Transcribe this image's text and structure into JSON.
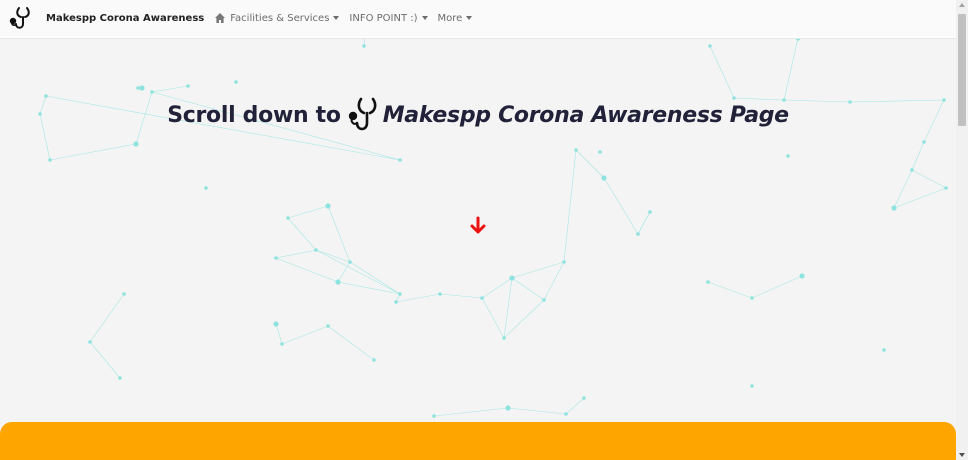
{
  "navbar": {
    "brand_text": "Makespp Corona Awareness",
    "items": [
      {
        "label": "Facilities & Services",
        "has_caret": true
      },
      {
        "label": "INFO POINT :)",
        "has_caret": true
      },
      {
        "label": "More",
        "has_caret": true
      }
    ],
    "home_icon": "home-icon",
    "logo_icon": "stethoscope-icon"
  },
  "hero": {
    "lead_text": "Scroll down to",
    "brand_text": "Makespp Corona Awareness Page",
    "icon": "stethoscope-icon",
    "scroll_icon": "arrow-down-icon"
  },
  "colors": {
    "background": "#f4f4f4",
    "particles": "#8fe3df",
    "headline": "#21213a",
    "arrow": "#ee1111",
    "panel": "#ffa500"
  }
}
